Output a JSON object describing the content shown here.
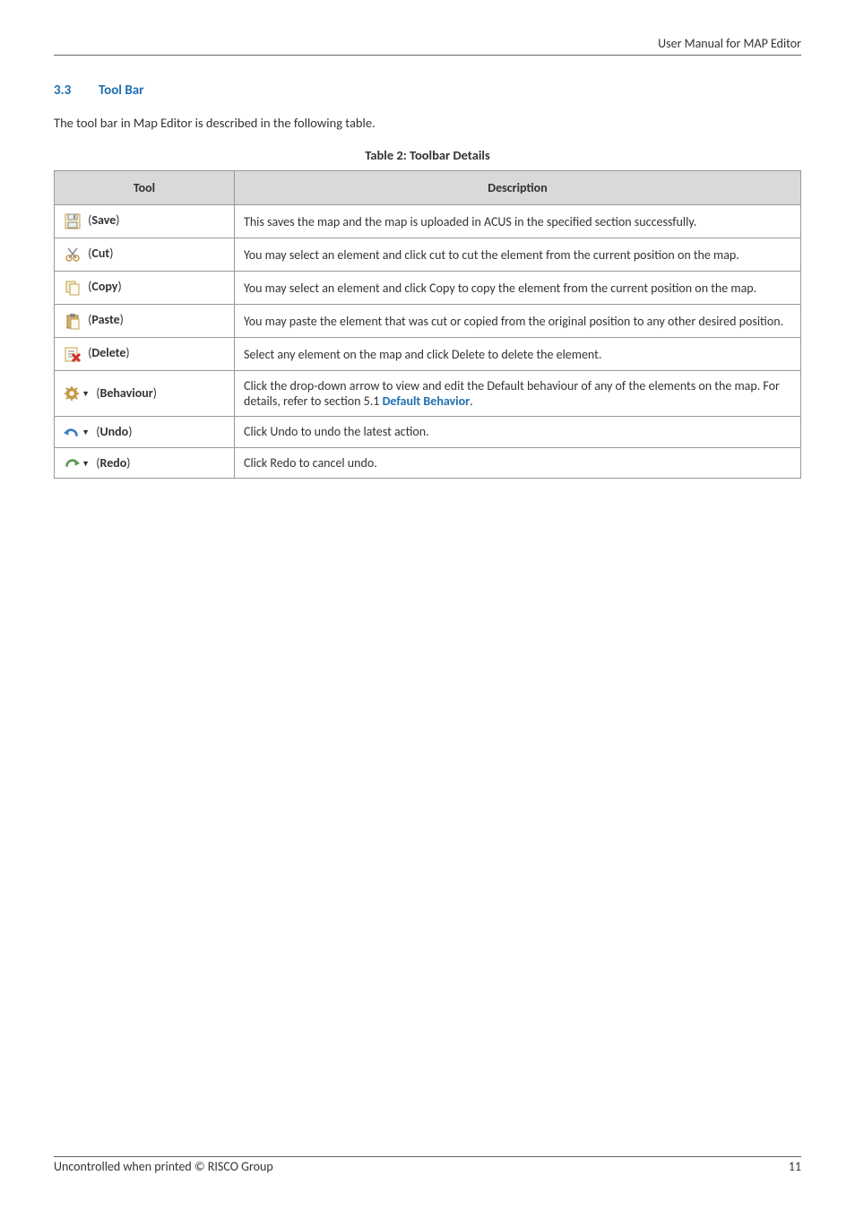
{
  "header": {
    "title": "User Manual for MAP Editor"
  },
  "section": {
    "number": "3.3",
    "title": "Tool Bar"
  },
  "intro": "The tool bar in Map Editor is described in the following table.",
  "table_caption": "Table 2: Toolbar Details",
  "table": {
    "headers": {
      "tool": "Tool",
      "description": "Description"
    },
    "rows": [
      {
        "tool_label": "Save",
        "description": "This saves the map and the map is uploaded in ACUS in the specified section successfully."
      },
      {
        "tool_label": "Cut",
        "description": "You may select an element and click cut to cut the element from the current position on the map."
      },
      {
        "tool_label": "Copy",
        "description": "You may select an element and click Copy to copy the element from the current position on the map."
      },
      {
        "tool_label": "Paste",
        "description": "You may paste the element that was cut or copied from the original position to any other desired position."
      },
      {
        "tool_label": "Delete",
        "description": "Select any element on the map and click Delete to delete the element."
      },
      {
        "tool_label": "Behaviour",
        "desc_prefix": "Click the drop-down arrow to view and edit the Default behaviour of any of the elements on the map. For details, refer to section 5.1 ",
        "desc_link": "Default Behavior",
        "desc_suffix": "."
      },
      {
        "tool_label": "Undo",
        "description": "Click Undo to undo the latest action."
      },
      {
        "tool_label": "Redo",
        "description": "Click Redo to cancel undo."
      }
    ]
  },
  "footer": {
    "left": "Uncontrolled when printed © RISCO Group",
    "right": "11"
  }
}
